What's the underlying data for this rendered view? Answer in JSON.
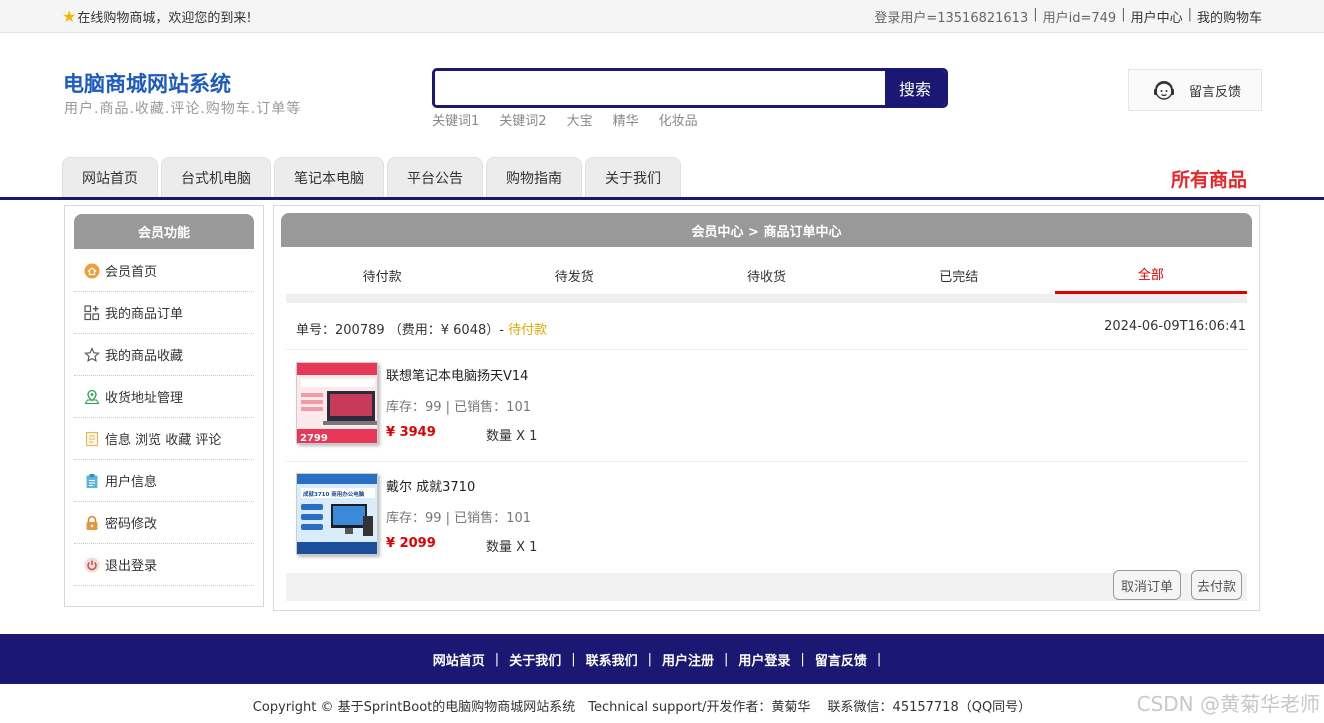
{
  "topbar": {
    "welcome": "在线购物商城，欢迎您的到来!",
    "login_user": "登录用户=13516821613",
    "user_id": "用户id=749",
    "user_center": "用户中心",
    "my_cart": "我的购物车",
    "separator": "|"
  },
  "header": {
    "site_title": "电脑商城网站系统",
    "site_subtitle": "用户.商品.收藏.评论.购物车.订单等",
    "search_placeholder": "",
    "search_button": "搜索",
    "keywords": [
      "关键词1",
      "关键词2",
      "大宝",
      "精华",
      "化妆品"
    ],
    "feedback": "留言反馈"
  },
  "nav": {
    "tabs": [
      "网站首页",
      "台式机电脑",
      "笔记本电脑",
      "平台公告",
      "购物指南",
      "关于我们"
    ],
    "all_goods": "所有商品"
  },
  "sidebar": {
    "title": "会员功能",
    "items": [
      "会员首页",
      "我的商品订单",
      "我的商品收藏",
      "收货地址管理",
      "信息 浏览 收藏 评论",
      "用户信息",
      "密码修改",
      "退出登录"
    ]
  },
  "main": {
    "breadcrumb": "会员中心 > 商品订单中心",
    "tabs": [
      "待付款",
      "待发货",
      "待收货",
      "已完结",
      "全部"
    ],
    "active_tab": "全部",
    "order": {
      "info": "单号：200789 （费用：¥ 6048）-",
      "status": "待付款",
      "time": "2024-06-09T16:06:41"
    },
    "items": [
      {
        "name": "联想笔记本电脑扬天V14",
        "stock": "库存：99 | 已销售：101",
        "price": "¥ 3949",
        "qty": "数量 X 1",
        "thumb_text": "2799"
      },
      {
        "name": "戴尔 成就3710",
        "stock": "库存：99 | 已销售：101",
        "price": "¥ 2099",
        "qty": "数量 X 1",
        "thumb_text": "成就3710 商用办公电脑"
      }
    ],
    "cancel_button": "取消订单",
    "pay_button": "去付款"
  },
  "footer": {
    "links": [
      "网站首页",
      "关于我们",
      "联系我们",
      "用户注册",
      "用户登录",
      "留言反馈"
    ],
    "separator": "|",
    "copyright": "Copyright © 基于SprintBoot的电脑购物商城网站系统　Technical support/开发作者：黄菊华　 联系微信：45157718（QQ同号）",
    "watermark": "CSDN @黄菊华老师"
  },
  "colors": {
    "brand_navy": "#1a1872",
    "title_blue": "#1f5bbd",
    "accent_red": "#e8262b",
    "status_orange": "#e0a800",
    "panel_grey": "#999999"
  }
}
